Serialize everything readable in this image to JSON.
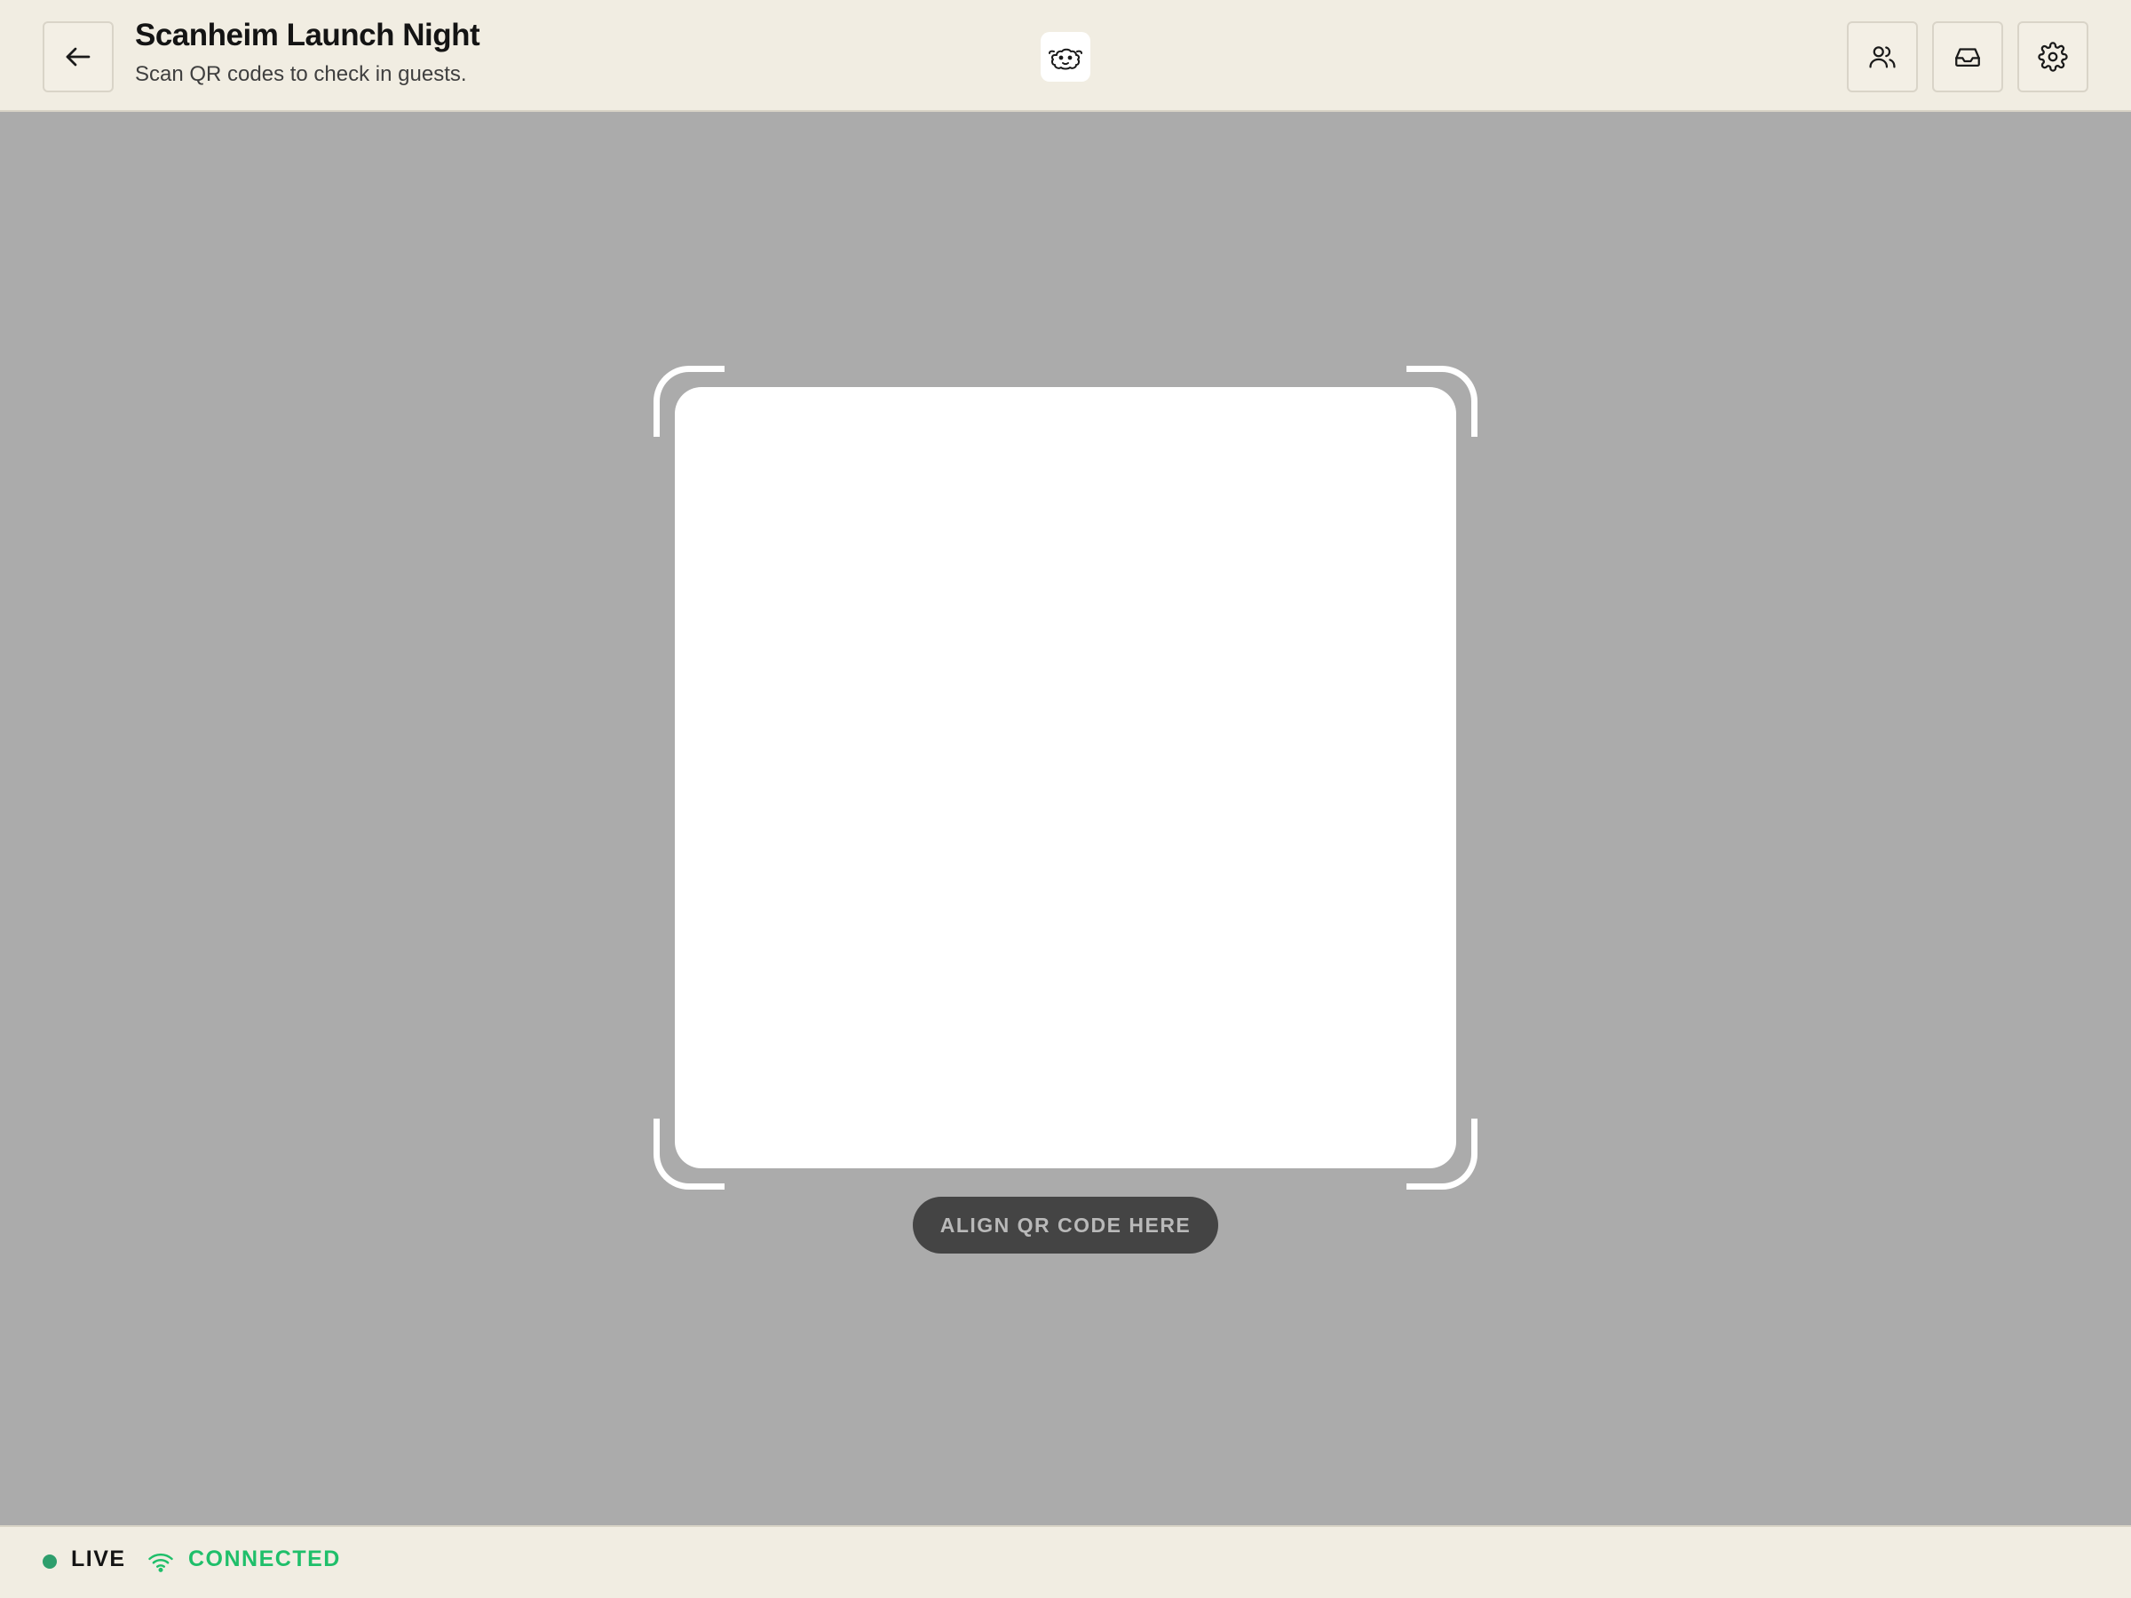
{
  "header": {
    "title": "Scanheim Launch Night",
    "subtitle": "Scan QR codes to check in guests."
  },
  "icons": {
    "back": "arrow-left-icon",
    "logo": "sheep-logo-icon",
    "users": "users-icon",
    "inbox": "inbox-icon",
    "settings": "gear-icon",
    "wifi": "wifi-icon"
  },
  "scanner": {
    "hint": "ALIGN QR CODE HERE"
  },
  "status": {
    "live_label": "LIVE",
    "connection_label": "CONNECTED"
  },
  "colors": {
    "header_bg": "#f1ede2",
    "scan_bg": "#ababab",
    "live_dot": "#2e9e6c",
    "connected": "#1fbf6a",
    "hint_pill": "#444444"
  }
}
